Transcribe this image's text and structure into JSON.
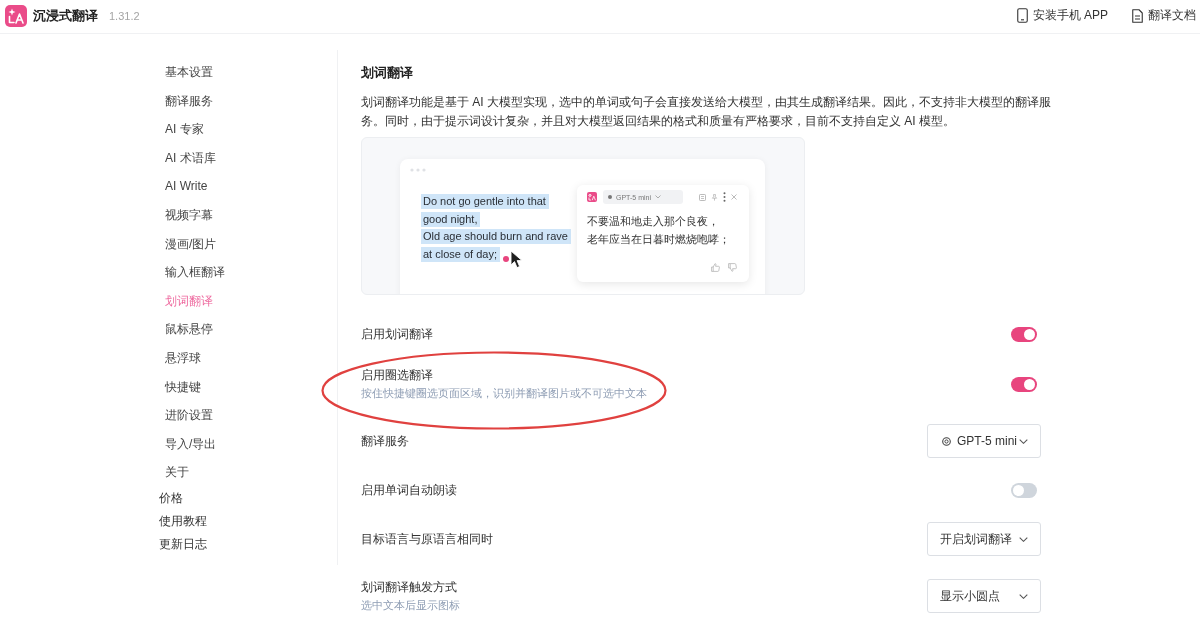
{
  "app": {
    "name": "沉浸式翻译",
    "version": "1.31.2"
  },
  "header_links": [
    {
      "kind": "mobile",
      "label": "安装手机 APP"
    },
    {
      "kind": "docs",
      "label": "翻译文档"
    }
  ],
  "sidebar": {
    "items": [
      {
        "label": "基本设置",
        "selected": false
      },
      {
        "label": "翻译服务",
        "selected": false
      },
      {
        "label": "AI 专家",
        "selected": false
      },
      {
        "label": "AI 术语库",
        "selected": false
      },
      {
        "label": "AI Write",
        "selected": false
      },
      {
        "label": "视频字幕",
        "selected": false
      },
      {
        "label": "漫画/图片",
        "selected": false
      },
      {
        "label": "输入框翻译",
        "selected": false
      },
      {
        "label": "划词翻译",
        "selected": true
      },
      {
        "label": "鼠标悬停",
        "selected": false
      },
      {
        "label": "悬浮球",
        "selected": false
      },
      {
        "label": "快捷键",
        "selected": false
      },
      {
        "label": "进阶设置",
        "selected": false
      },
      {
        "label": "导入/导出",
        "selected": false
      },
      {
        "label": "关于",
        "selected": false
      }
    ],
    "links": [
      {
        "label": "价格"
      },
      {
        "label": "使用教程"
      },
      {
        "label": "更新日志"
      }
    ]
  },
  "section": {
    "title": "划词翻译",
    "description": "划词翻译功能是基于 AI 大模型实现，选中的单词或句子会直接发送给大模型，由其生成翻译结果。因此，不支持非大模型的翻译服务。同时，由于提示词设计复杂，并且对大模型返回结果的格式和质量有严格要求，目前不支持自定义 AI 模型。"
  },
  "preview": {
    "source_lines": [
      "Do not go gentle into that",
      "good night,",
      "Old age should burn and rave",
      "at close of day;"
    ],
    "popup": {
      "model": "GPT-5 mini",
      "translation_lines": [
        "不要温和地走入那个良夜，",
        "老年应当在日暮时燃烧咆哮；"
      ]
    }
  },
  "settings": [
    {
      "kind": "toggle",
      "label": "启用划词翻译",
      "on": true,
      "circled": false
    },
    {
      "kind": "toggle",
      "label": "启用圈选翻译",
      "description": "按住快捷键圈选页面区域，识别并翻译图片或不可选中文本",
      "on": true,
      "circled": true
    },
    {
      "kind": "select",
      "label": "翻译服务",
      "value": "GPT-5 mini",
      "icon": true,
      "circled": false
    },
    {
      "kind": "toggle",
      "label": "启用单词自动朗读",
      "on": false,
      "circled": false
    },
    {
      "kind": "select",
      "label": "目标语言与原语言相同时",
      "value": "开启划词翻译",
      "icon": false,
      "circled": false
    },
    {
      "kind": "select",
      "label": "划词翻译触发方式",
      "description": "选中文本后显示图标",
      "value": "显示小圆点",
      "icon": false,
      "circled": false
    }
  ]
}
